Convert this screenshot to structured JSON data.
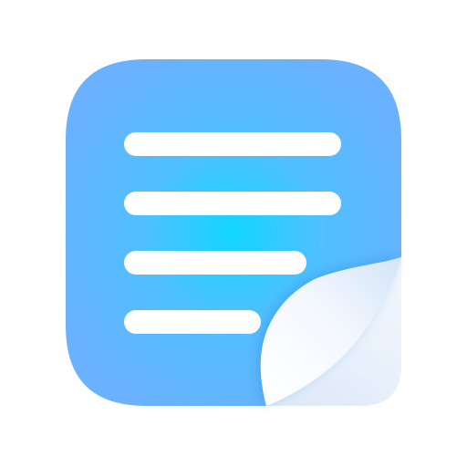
{
  "icon": {
    "name": "notes-document-app-icon",
    "line_count": 4,
    "colors": {
      "background_page": "#ffffff",
      "tile_center": "#11D6FF",
      "tile_mid": "#4FC0FF",
      "tile_edge": "#6AB1FF",
      "text_lines": "#ffffff",
      "page_curl_light": "#ffffff",
      "page_curl_shade": "#e4eefb",
      "page_curl_fold": "#cfe1f6"
    }
  }
}
